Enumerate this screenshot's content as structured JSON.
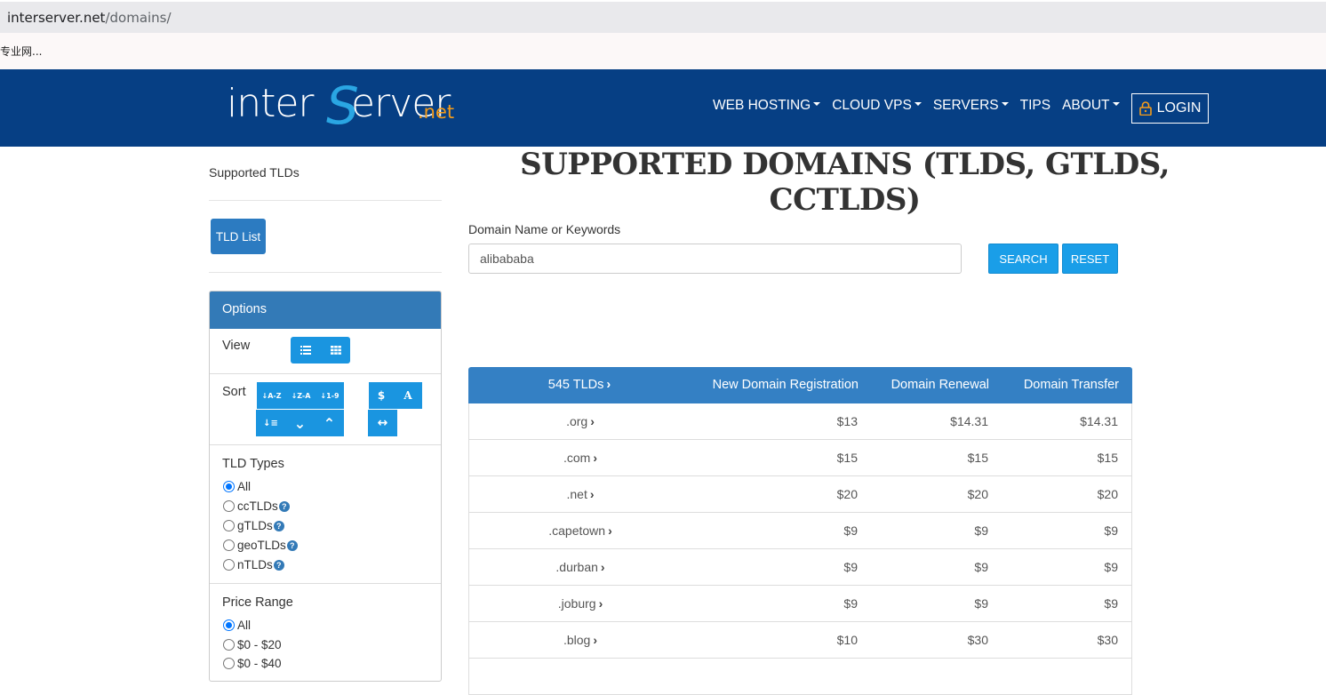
{
  "browser": {
    "url_host": "interserver.net",
    "url_path": "/domains/",
    "bookmark": "专业网..."
  },
  "header": {
    "logo_inter": "inter",
    "logo_s": "S",
    "logo_erver": "erver",
    "logo_net": ".net",
    "nav": [
      "WEB HOSTING",
      "CLOUD VPS",
      "SERVERS",
      "TIPS",
      "ABOUT"
    ],
    "login": "LOGIN",
    "colors": {
      "header_bg": "#063f84",
      "accent_orange": "#f59c1a",
      "accent_blue": "#2aa6e3"
    }
  },
  "sidebar": {
    "title": "Supported TLDs",
    "tld_list_button": "TLD List",
    "options_title": "Options",
    "view_label": "View",
    "sort_label": "Sort",
    "tld_types_label": "TLD Types",
    "tld_types": [
      "All",
      "ccTLDs",
      "gTLDs",
      "geoTLDs",
      "nTLDs"
    ],
    "tld_types_selected": "All",
    "price_range_label": "Price Range",
    "price_ranges": [
      "All",
      "$0 - $20",
      "$0 - $40"
    ],
    "price_range_selected": "All",
    "sort_glyphs": {
      "az": "↓A-Z",
      "za": "↓Z-A",
      "num": "↓1-9",
      "dollar": "$",
      "alpha": "A",
      "len": "↓≡",
      "down": "⌄",
      "up": "⌃",
      "both": "↔"
    }
  },
  "main": {
    "title": "SUPPORTED DOMAINS (TLDS, GTLDS, CCTLDS)",
    "search_label": "Domain Name or Keywords",
    "search_value": "alibababa",
    "search_button": "SEARCH",
    "reset_button": "RESET",
    "table": {
      "headers": [
        "545 TLDs",
        "New Domain Registration",
        "Domain Renewal",
        "Domain Transfer"
      ],
      "rows": [
        {
          "tld": ".org",
          "new": "$13",
          "renew": "$14.31",
          "transfer": "$14.31"
        },
        {
          "tld": ".com",
          "new": "$15",
          "renew": "$15",
          "transfer": "$15"
        },
        {
          "tld": ".net",
          "new": "$20",
          "renew": "$20",
          "transfer": "$20"
        },
        {
          "tld": ".capetown",
          "new": "$9",
          "renew": "$9",
          "transfer": "$9"
        },
        {
          "tld": ".durban",
          "new": "$9",
          "renew": "$9",
          "transfer": "$9"
        },
        {
          "tld": ".joburg",
          "new": "$9",
          "renew": "$9",
          "transfer": "$9"
        },
        {
          "tld": ".blog",
          "new": "$10",
          "renew": "$30",
          "transfer": "$30"
        }
      ]
    }
  }
}
